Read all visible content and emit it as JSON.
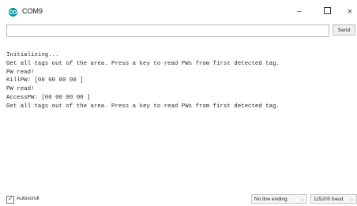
{
  "window": {
    "title": "COM9",
    "icon": "arduino-icon",
    "controls": {
      "minimize": "–",
      "close": "×"
    }
  },
  "input": {
    "value": "",
    "placeholder": "",
    "send_label": "Send"
  },
  "output": {
    "lines": [
      "Initializing...",
      "Get all tags out of the area. Press a key to read PWs from first detected tag.",
      "PW read!",
      "KillPW: [00 00 00 00 ]",
      "PW read!",
      "AccessPW: [00 00 00 00 ]",
      "Get all tags out of the area. Press a key to read PWs from first detected tag."
    ]
  },
  "status": {
    "autoscroll_label": "Autoscroll",
    "autoscroll_checked": true,
    "checkmark": "✓",
    "line_ending": "No line ending",
    "baud_rate": "115200 baud",
    "chevron": "⌄"
  },
  "colors": {
    "accent": "#00979c"
  }
}
